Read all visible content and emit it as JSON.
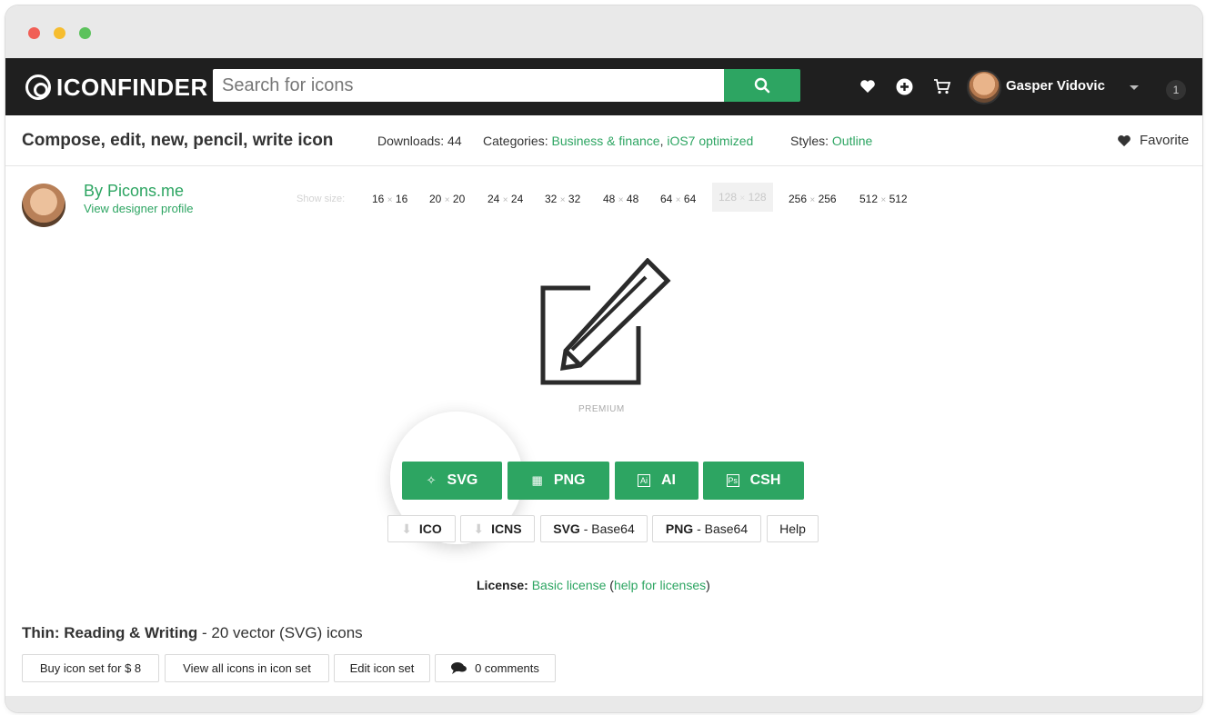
{
  "navbar": {
    "logo_text": "ICONFINDER",
    "search_placeholder": "Search for icons",
    "user_name": "Gasper Vidovic",
    "notification_count": "1"
  },
  "icon_info": {
    "title": "Compose, edit, new, pencil, write icon",
    "downloads_label": "Downloads: 44",
    "categories_label": "Categories:",
    "category_1": "Business & finance",
    "category_2": "iOS7 optimized",
    "styles_label": "Styles:",
    "style": "Outline",
    "favorite_label": "Favorite"
  },
  "designer": {
    "by_label": "By Picons.me",
    "profile_link": "View designer profile"
  },
  "sizes": {
    "label": "Show size:",
    "items": [
      {
        "w": "16",
        "h": "16"
      },
      {
        "w": "20",
        "h": "20"
      },
      {
        "w": "24",
        "h": "24"
      },
      {
        "w": "32",
        "h": "32"
      },
      {
        "w": "48",
        "h": "48"
      },
      {
        "w": "64",
        "h": "64"
      },
      {
        "w": "128",
        "h": "128"
      },
      {
        "w": "256",
        "h": "256"
      },
      {
        "w": "512",
        "h": "512"
      }
    ],
    "separator": "×",
    "selected": "128"
  },
  "preview": {
    "badge": "PREMIUM"
  },
  "downloads": {
    "primary": [
      "SVG",
      "PNG",
      "AI",
      "CSH"
    ],
    "ai_box": "Ai",
    "csh_box": "Ps",
    "secondary": {
      "ico": "ICO",
      "icns": "ICNS",
      "svg_b64_bold": "SVG",
      "svg_b64_rest": " - Base64",
      "png_b64_bold": "PNG",
      "png_b64_rest": " - Base64",
      "help": "Help"
    }
  },
  "license": {
    "label": "License:",
    "link": "Basic license",
    "help_open": " (",
    "help_link": "help for licenses",
    "help_close": ")"
  },
  "icon_set": {
    "name": "Thin: Reading & Writing",
    "suffix": " - 20 vector (SVG) icons",
    "buttons": {
      "buy": "Buy icon set for $ 8",
      "view_all": "View all icons in icon set",
      "edit": "Edit icon set",
      "comments": "0 comments"
    }
  },
  "colors": {
    "accent": "#2da562",
    "navbar": "#1f1f1f"
  }
}
